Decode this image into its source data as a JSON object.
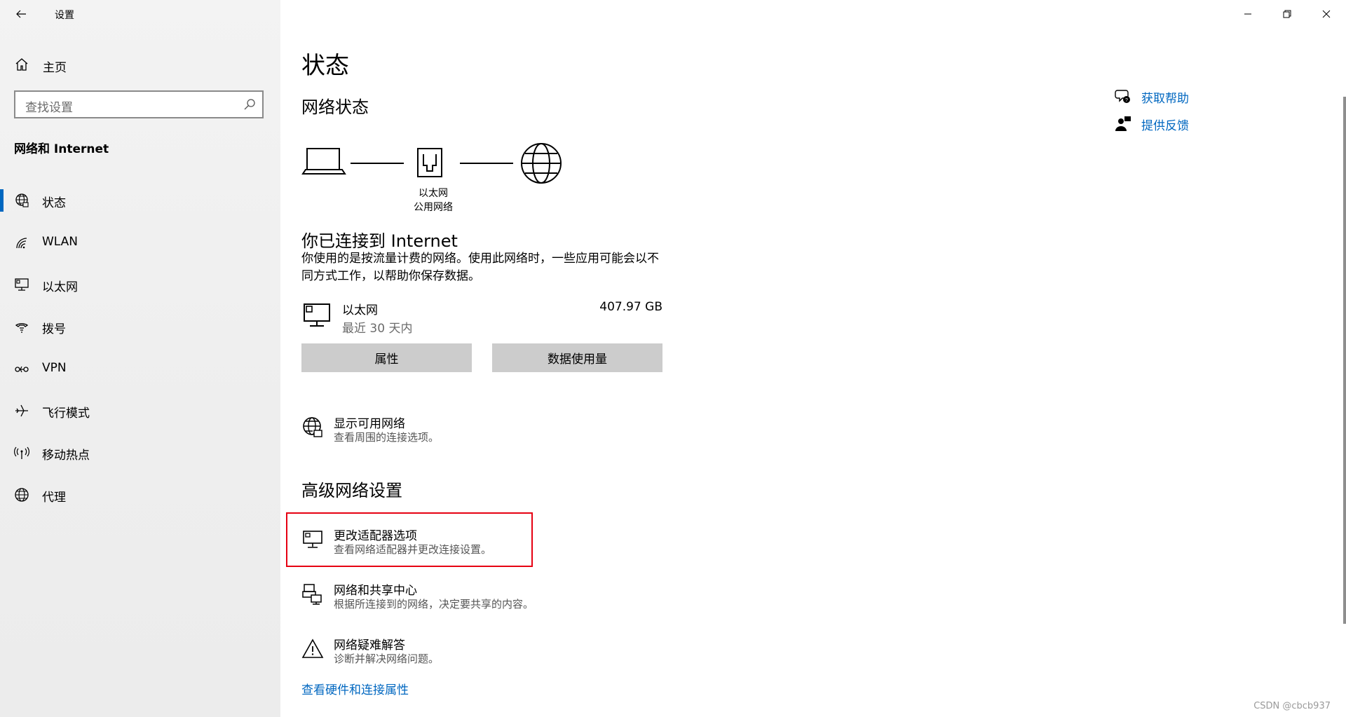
{
  "window": {
    "title": "设置"
  },
  "sidebar": {
    "home_label": "主页",
    "search_placeholder": "查找设置",
    "section_title": "网络和 Internet",
    "items": [
      {
        "label": "状态",
        "icon": "globe-network-icon",
        "active": true
      },
      {
        "label": "WLAN",
        "icon": "wifi-icon"
      },
      {
        "label": "以太网",
        "icon": "ethernet-monitor-icon"
      },
      {
        "label": "拨号",
        "icon": "dialup-icon"
      },
      {
        "label": "VPN",
        "icon": "vpn-icon"
      },
      {
        "label": "飞行模式",
        "icon": "airplane-icon"
      },
      {
        "label": "移动热点",
        "icon": "hotspot-icon"
      },
      {
        "label": "代理",
        "icon": "globe-icon"
      }
    ]
  },
  "main": {
    "title": "状态",
    "network_status_heading": "网络状态",
    "diagram": {
      "line1": "以太网",
      "line2": "公用网络"
    },
    "connected_heading": "你已连接到 Internet",
    "connected_desc": "你使用的是按流量计费的网络。使用此网络时，一些应用可能会以不同方式工作，以帮助你保存数据。",
    "ethernet": {
      "name": "以太网",
      "period": "最近 30 天内",
      "usage": "407.97 GB"
    },
    "buttons": {
      "properties": "属性",
      "data_usage": "数据使用量"
    },
    "show_networks": {
      "title": "显示可用网络",
      "desc": "查看周围的连接选项。"
    },
    "advanced_heading": "高级网络设置",
    "advanced": [
      {
        "title": "更改适配器选项",
        "desc": "查看网络适配器并更改连接设置。"
      },
      {
        "title": "网络和共享中心",
        "desc": "根据所连接到的网络，决定要共享的内容。"
      },
      {
        "title": "网络疑难解答",
        "desc": "诊断并解决网络问题。"
      }
    ],
    "hardware_link": "查看硬件和连接属性"
  },
  "help": {
    "get_help": "获取帮助",
    "feedback": "提供反馈"
  },
  "watermark": "CSDN @cbcb937",
  "colors": {
    "accent": "#0067c0",
    "highlight": "#e60012",
    "button": "#cccccc"
  }
}
